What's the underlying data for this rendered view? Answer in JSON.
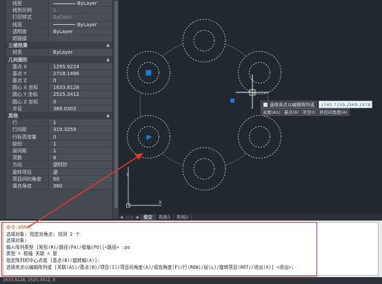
{
  "palette": {
    "rows": [
      {
        "type": "prop",
        "key": "线型",
        "value": "ByLayer",
        "swatch": true
      },
      {
        "type": "prop",
        "key": "线型比例",
        "value": "1",
        "dim": true
      },
      {
        "type": "prop",
        "key": "打印样式",
        "value": "ByColor",
        "dim": true
      },
      {
        "type": "prop",
        "key": "线宽",
        "value": "ByLayer",
        "swatch": true
      },
      {
        "type": "prop",
        "key": "透明度",
        "value": "ByLayer"
      },
      {
        "type": "prop",
        "key": "超链接",
        "value": ""
      },
      {
        "type": "section",
        "key": "三维效果"
      },
      {
        "type": "prop",
        "key": "材质",
        "value": "ByLayer"
      },
      {
        "type": "section",
        "key": "几何图形"
      },
      {
        "type": "prop",
        "key": "基点 X",
        "value": "1295.9224"
      },
      {
        "type": "prop",
        "key": "基点 Y",
        "value": "2718.1486"
      },
      {
        "type": "prop",
        "key": "基点 Z",
        "value": "0"
      },
      {
        "type": "prop",
        "key": "圆心 X 坐标",
        "value": "1633.8128"
      },
      {
        "type": "prop",
        "key": "圆心 Y 坐标",
        "value": "2525.3412"
      },
      {
        "type": "prop",
        "key": "圆心 Z 坐标",
        "value": "0"
      },
      {
        "type": "prop",
        "key": "半径",
        "value": "389.0303"
      },
      {
        "type": "section",
        "key": "其他"
      },
      {
        "type": "prop",
        "key": "行",
        "value": "1"
      },
      {
        "type": "prop",
        "key": "行间距",
        "value": "319.3259"
      },
      {
        "type": "prop",
        "key": "行标高增量",
        "value": "0"
      },
      {
        "type": "prop",
        "key": "级别",
        "value": "1"
      },
      {
        "type": "prop",
        "key": "层间距",
        "value": "1"
      },
      {
        "type": "prop",
        "key": "项数",
        "value": "6"
      },
      {
        "type": "prop",
        "key": "方向",
        "value": "逆时针"
      },
      {
        "type": "prop",
        "key": "旋转项目",
        "value": "是"
      },
      {
        "type": "prop",
        "key": "项目间的角度",
        "value": "60"
      },
      {
        "type": "prop",
        "key": "填充角度",
        "value": "360"
      }
    ]
  },
  "tooltip": {
    "prompt": "选择夹点以编辑阵列或",
    "value": "1740.7159,2569.2478",
    "options": [
      "关联(AS)",
      "基点(B)",
      "项目(I)",
      "项目间角度(A)"
    ]
  },
  "tabs": {
    "items": [
      "模型",
      "布局1",
      "布局2"
    ],
    "active": 0
  },
  "command": {
    "lines": [
      "命令:ARRAY",
      "选择对象: 指定对角点: 找到 2 个",
      "选择对象:",
      "输入阵列类型 [矩形(R)/路径(PA)/极轴(PO)]<路径> :po",
      "类型 = 极轴  关联 = 是",
      "指定阵列的中心点或 [基点(B)/旋转轴(A)]:",
      "选择夹点以编辑阵列或 [关联(AS)/基点(B)/项目(I)/项目间角度(A)/填充角度(F)/行(ROW)/层(L)/旋转项目(ROT)/退出(X)] <退出>:"
    ]
  },
  "status": {
    "coords": "1633.8128, 2525.3412, 0"
  },
  "ucs": {
    "x": "X",
    "y": "Y"
  },
  "colors": {
    "canvas": "#212830",
    "grip": "#1e7bd6",
    "annotation": "#e23a2f"
  }
}
